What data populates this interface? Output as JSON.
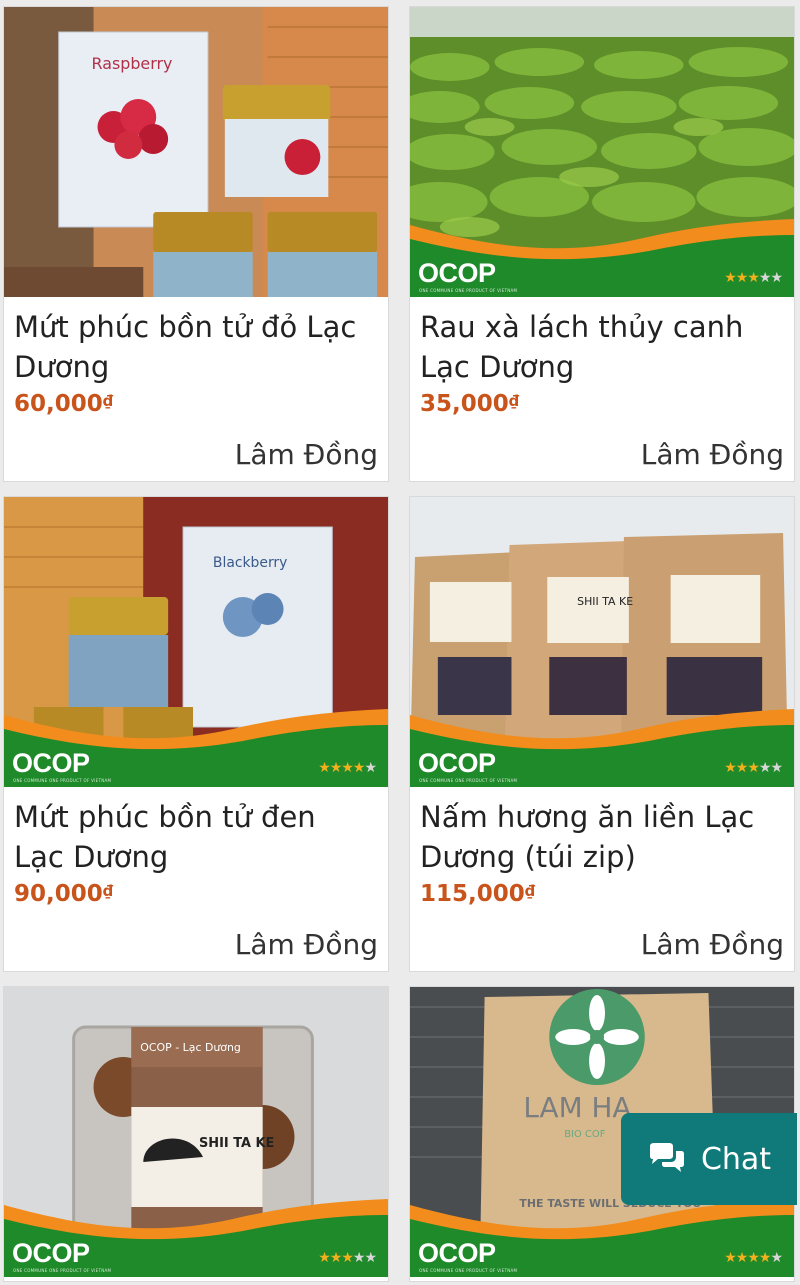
{
  "products": [
    {
      "name_line1": "Mứt phúc bồn tử đỏ Lạc",
      "name_line2": "Dương",
      "price": "60,000",
      "currency": "₫",
      "origin": "Lâm Đồng",
      "stars": 0,
      "has_ocop": false,
      "image_text": "Raspberry"
    },
    {
      "name_line1": "Rau xà lách thủy canh",
      "name_line2": "Lạc Dương",
      "price": "35,000",
      "currency": "₫",
      "origin": "Lâm Đồng",
      "stars": 3,
      "has_ocop": true
    },
    {
      "name_line1": "Mứt phúc bồn tử đen",
      "name_line2": "Lạc Dương",
      "price": "90,000",
      "currency": "₫",
      "origin": "Lâm Đồng",
      "stars": 4,
      "has_ocop": true,
      "image_text": "Blackberry"
    },
    {
      "name_line1": "Nấm hương ăn liền Lạc",
      "name_line2": "Dương (túi zip)",
      "price": "115,000",
      "currency": "₫",
      "origin": "Lâm Đồng",
      "stars": 3,
      "has_ocop": true,
      "image_text": "SHII TA KE"
    },
    {
      "stars": 3,
      "has_ocop": true,
      "image_text_1": "OCOP - Lạc Dương",
      "image_text_2": "SHII TA KE"
    },
    {
      "stars": 4,
      "has_ocop": true,
      "image_text_1": "LAM HA",
      "image_text_2": "BIO COF",
      "image_text_3": "THE TASTE WILL SEDUCE YOU"
    }
  ],
  "ocop": {
    "logo": "OCOP",
    "tagline": "ONE COMMUNE ONE PRODUCT OF VIETNAM"
  },
  "chat": {
    "label": "Chat",
    "icon": "chat-bubbles-icon",
    "color": "#10797a"
  },
  "colors": {
    "price": "#c8541c",
    "ocop_green": "#1f8a2a",
    "ocop_orange": "#f28c1c",
    "star": "#f2b01e"
  }
}
